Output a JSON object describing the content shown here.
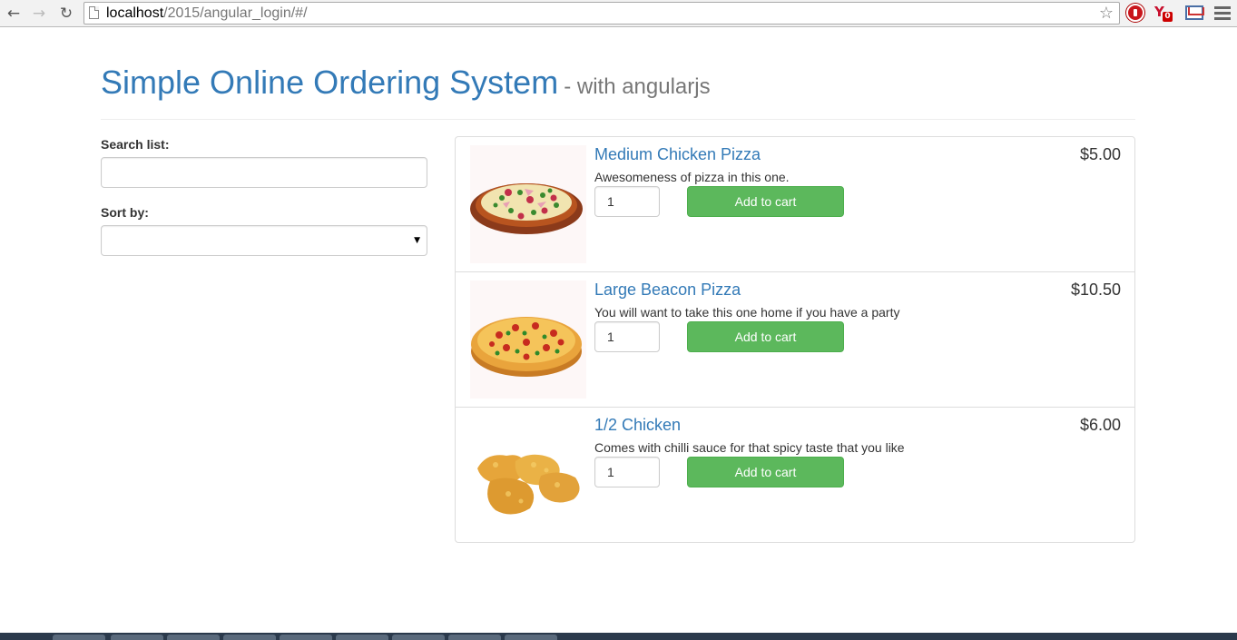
{
  "browser": {
    "url_host": "localhost",
    "url_path": "/2015/angular_login/#/",
    "ext_badge": "0"
  },
  "header": {
    "title": "Simple Online Ordering System",
    "subtitle": "- with angularjs"
  },
  "sidebar": {
    "search_label": "Search list:",
    "search_value": "",
    "sort_label": "Sort by:",
    "sort_value": ""
  },
  "items": [
    {
      "name": "Medium Chicken Pizza",
      "price": "$5.00",
      "description": "Awesomeness of pizza in this one.",
      "qty": "1",
      "button": "Add to cart",
      "image": "pizza-icon"
    },
    {
      "name": "Large Beacon Pizza",
      "price": "$10.50",
      "description": "You will want to take this one home if you have a party",
      "qty": "1",
      "button": "Add to cart",
      "image": "pizza-icon"
    },
    {
      "name": "1/2 Chicken",
      "price": "$6.00",
      "description": "Comes with chilli sauce for that spicy taste that you like",
      "qty": "1",
      "button": "Add to cart",
      "image": "chicken-nuggets-icon"
    }
  ],
  "colors": {
    "link": "#337ab7",
    "success": "#5cb85c"
  }
}
